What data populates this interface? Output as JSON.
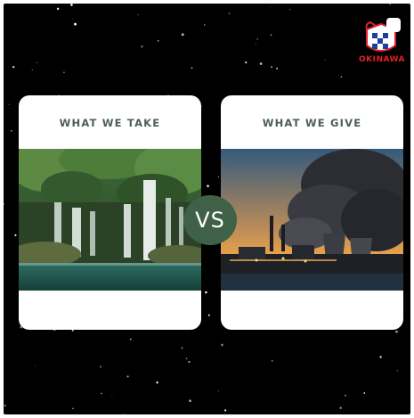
{
  "cards": {
    "left": {
      "title": "WHAT WE TAKE",
      "image": "waterfall-photo"
    },
    "right": {
      "title": "WHAT WE GIVE",
      "image": "power-plant-smoke-photo"
    }
  },
  "vs_label": "VS",
  "logo": {
    "text": "OKINAWA",
    "icon": "okinawa-logo-icon"
  },
  "colors": {
    "background": "#000000",
    "card": "#ffffff",
    "vs_badge": "#3f6148",
    "title_text": "#4d5e55",
    "logo_red": "#e0202a"
  }
}
